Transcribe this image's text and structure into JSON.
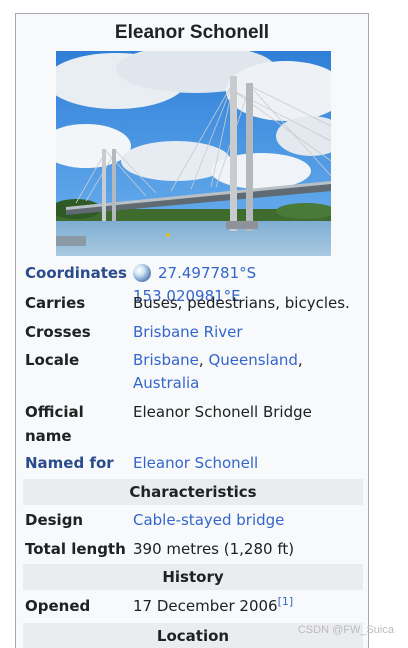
{
  "infobox": {
    "title": "Eleanor Schonell",
    "image_alt": "Eleanor Schonell Bridge over the Brisbane River",
    "rows": [
      {
        "label": "Coordinates",
        "value": "27.497781°S 153.020981°E"
      },
      {
        "label": "Carries",
        "value": "Buses, pedestrians, bicycles."
      },
      {
        "label": "Crosses",
        "value": "Brisbane River"
      },
      {
        "label": "Locale",
        "value_part1": "Brisbane",
        "sep": ", ",
        "value_part2": "Queensland",
        "value_part3": "Australia"
      },
      {
        "label_line1": "Official",
        "label_line2": "name",
        "value": "Eleanor Schonell Bridge"
      },
      {
        "label": "Named for",
        "value": "Eleanor Schonell"
      }
    ],
    "characteristics": {
      "header": "Characteristics",
      "rows": [
        {
          "label": "Design",
          "value": "Cable-stayed bridge"
        },
        {
          "label": "Total length",
          "value": "390 metres (1,280 ft)"
        }
      ]
    },
    "history": {
      "header": "History",
      "rows": [
        {
          "label": "Opened",
          "value": "17 December 2006",
          "ref": "[1]"
        }
      ]
    },
    "location": {
      "header": "Location"
    }
  },
  "watermark": "CSDN @FW_Suica",
  "colors": {
    "link": "#3366cc",
    "header_bg": "#eaecf0",
    "box_bg": "#f8f9fa",
    "border": "#a2a9b1"
  }
}
